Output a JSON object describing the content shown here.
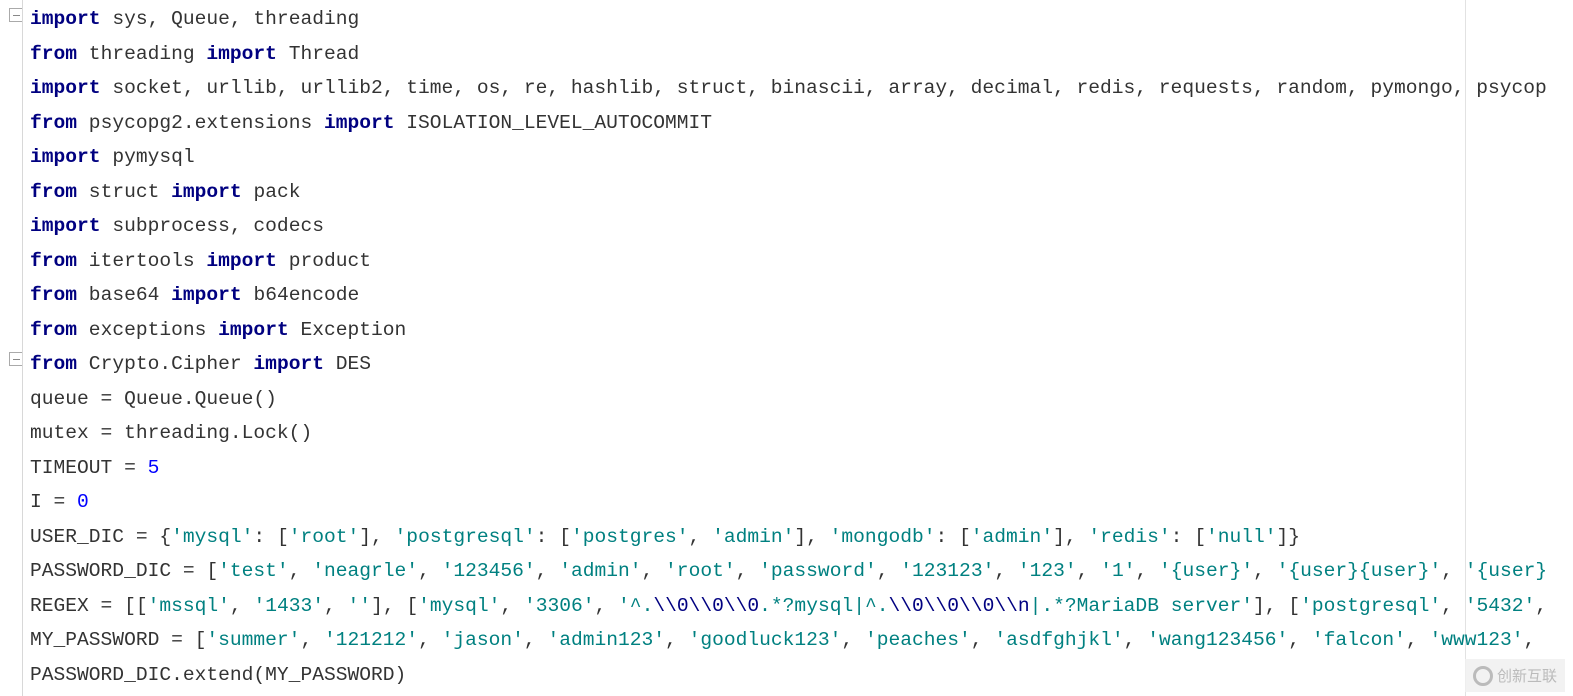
{
  "editor": {
    "colors": {
      "keyword": "#000080",
      "string": "#008080",
      "number": "#0000ff",
      "text": "#333333"
    },
    "fold_icons": [
      "fold-icon",
      "fold-icon"
    ],
    "lines": [
      [
        [
          "k",
          "import"
        ],
        [
          "t",
          " sys, Queue, threading"
        ]
      ],
      [
        [
          "k",
          "from"
        ],
        [
          "t",
          " threading "
        ],
        [
          "k",
          "import"
        ],
        [
          "t",
          " Thread"
        ]
      ],
      [
        [
          "k",
          "import"
        ],
        [
          "t",
          " socket, urllib, urllib2, time, os, re, hashlib, struct, binascii, array, decimal, redis, requests, random, pymongo, psycop"
        ]
      ],
      [
        [
          "k",
          "from"
        ],
        [
          "t",
          " psycopg2.extensions "
        ],
        [
          "k",
          "import"
        ],
        [
          "t",
          " ISOLATION_LEVEL_AUTOCOMMIT"
        ]
      ],
      [
        [
          "k",
          "import"
        ],
        [
          "t",
          " pymysql"
        ]
      ],
      [
        [
          "k",
          "from"
        ],
        [
          "t",
          " struct "
        ],
        [
          "k",
          "import"
        ],
        [
          "t",
          " pack"
        ]
      ],
      [
        [
          "k",
          "import"
        ],
        [
          "t",
          " subprocess, codecs"
        ]
      ],
      [
        [
          "k",
          "from"
        ],
        [
          "t",
          " itertools "
        ],
        [
          "k",
          "import"
        ],
        [
          "t",
          " product"
        ]
      ],
      [
        [
          "k",
          "from"
        ],
        [
          "t",
          " base64 "
        ],
        [
          "k",
          "import"
        ],
        [
          "t",
          " b64encode"
        ]
      ],
      [
        [
          "k",
          "from"
        ],
        [
          "t",
          " exceptions "
        ],
        [
          "k",
          "import"
        ],
        [
          "t",
          " Exception"
        ]
      ],
      [
        [
          "k",
          "from"
        ],
        [
          "t",
          " Crypto.Cipher "
        ],
        [
          "k",
          "import"
        ],
        [
          "t",
          " DES"
        ]
      ],
      [
        [
          "t",
          "queue = Queue.Queue()"
        ]
      ],
      [
        [
          "t",
          "mutex = threading.Lock()"
        ]
      ],
      [
        [
          "t",
          "TIMEOUT = "
        ],
        [
          "n",
          "5"
        ]
      ],
      [
        [
          "t",
          "I = "
        ],
        [
          "n",
          "0"
        ]
      ],
      [
        [
          "t",
          "USER_DIC = {"
        ],
        [
          "s",
          "'mysql'"
        ],
        [
          "t",
          ": ["
        ],
        [
          "s",
          "'root'"
        ],
        [
          "t",
          "], "
        ],
        [
          "s",
          "'postgresql'"
        ],
        [
          "t",
          ": ["
        ],
        [
          "s",
          "'postgres'"
        ],
        [
          "t",
          ", "
        ],
        [
          "s",
          "'admin'"
        ],
        [
          "t",
          "], "
        ],
        [
          "s",
          "'mongodb'"
        ],
        [
          "t",
          ": ["
        ],
        [
          "s",
          "'admin'"
        ],
        [
          "t",
          "], "
        ],
        [
          "s",
          "'redis'"
        ],
        [
          "t",
          ": ["
        ],
        [
          "s",
          "'null'"
        ],
        [
          "t",
          "]}"
        ]
      ],
      [
        [
          "t",
          "PASSWORD_DIC = ["
        ],
        [
          "s",
          "'test'"
        ],
        [
          "t",
          ", "
        ],
        [
          "s",
          "'neagrle'"
        ],
        [
          "t",
          ", "
        ],
        [
          "s",
          "'123456'"
        ],
        [
          "t",
          ", "
        ],
        [
          "s",
          "'admin'"
        ],
        [
          "t",
          ", "
        ],
        [
          "s",
          "'root'"
        ],
        [
          "t",
          ", "
        ],
        [
          "s",
          "'password'"
        ],
        [
          "t",
          ", "
        ],
        [
          "s",
          "'123123'"
        ],
        [
          "t",
          ", "
        ],
        [
          "s",
          "'123'"
        ],
        [
          "t",
          ", "
        ],
        [
          "s",
          "'1'"
        ],
        [
          "t",
          ", "
        ],
        [
          "s",
          "'{user}'"
        ],
        [
          "t",
          ", "
        ],
        [
          "s",
          "'{user}{user}'"
        ],
        [
          "t",
          ", "
        ],
        [
          "s",
          "'{user}"
        ]
      ],
      [
        [
          "t",
          "REGEX = [["
        ],
        [
          "s",
          "'mssql'"
        ],
        [
          "t",
          ", "
        ],
        [
          "s",
          "'1433'"
        ],
        [
          "t",
          ", "
        ],
        [
          "s",
          "''"
        ],
        [
          "t",
          "], ["
        ],
        [
          "s",
          "'mysql'"
        ],
        [
          "t",
          ", "
        ],
        [
          "s",
          "'3306'"
        ],
        [
          "t",
          ", "
        ],
        [
          "s",
          "'^."
        ],
        [
          "e",
          "\\\\0\\\\0\\\\0"
        ],
        [
          "s",
          ".*?mysql|^."
        ],
        [
          "e",
          "\\\\0\\\\0\\\\0\\\\n"
        ],
        [
          "s",
          "|.*?MariaDB server'"
        ],
        [
          "t",
          "], ["
        ],
        [
          "s",
          "'postgresql'"
        ],
        [
          "t",
          ", "
        ],
        [
          "s",
          "'5432'"
        ],
        [
          "t",
          ","
        ]
      ],
      [
        [
          "t",
          "MY_PASSWORD = ["
        ],
        [
          "s",
          "'summer'"
        ],
        [
          "t",
          ", "
        ],
        [
          "s",
          "'121212'"
        ],
        [
          "t",
          ", "
        ],
        [
          "s",
          "'jason'"
        ],
        [
          "t",
          ", "
        ],
        [
          "s",
          "'admin123'"
        ],
        [
          "t",
          ", "
        ],
        [
          "s",
          "'goodluck123'"
        ],
        [
          "t",
          ", "
        ],
        [
          "s",
          "'peaches'"
        ],
        [
          "t",
          ", "
        ],
        [
          "s",
          "'asdfghjkl'"
        ],
        [
          "t",
          ", "
        ],
        [
          "s",
          "'wang123456'"
        ],
        [
          "t",
          ", "
        ],
        [
          "s",
          "'falcon'"
        ],
        [
          "t",
          ", "
        ],
        [
          "s",
          "'www123'"
        ],
        [
          "t",
          ","
        ]
      ],
      [
        [
          "t",
          "PASSWORD_DIC.extend(MY_PASSWORD)"
        ]
      ]
    ]
  },
  "watermark": {
    "text": "创新互联"
  }
}
